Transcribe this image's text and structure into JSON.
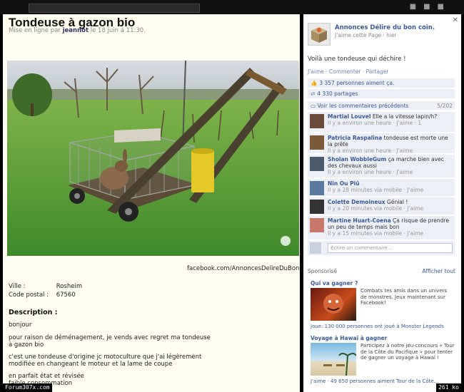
{
  "ad": {
    "title": "Tondeuse à gazon bio",
    "meta_prefix": "Mise en ligne par",
    "author": "jeannot",
    "meta_date": "le 18 juin à 11:30.",
    "watermark": "facebook.com/AnnoncesDelireDuBonCoin",
    "ville_label": "Ville :",
    "ville_value": "Rosheim",
    "cp_label": "Code postal :",
    "cp_value": "67560",
    "description_label": "Description :",
    "description": [
      "bonjour",
      "pour raison de déménagement, je vends avec regret ma tondeuse",
      "à gazon bio",
      "c'est une tondeuse d'origine jc motoculture que j'ai légèrement",
      "modifiée en changeant le moteur et la lame de coupe",
      "en parfait état et révisée",
      "faible consommation"
    ]
  },
  "fb": {
    "page_name": "Annonces Délire du bon coin.",
    "page_sub": "J'aime cette Page · hier",
    "post_text": "Voilà une tondeuse qui déchire !",
    "actions": "J'aime · Commenter · Partager",
    "likes": "3 357 personnes aiment ça.",
    "shares": "4 330 partages",
    "previous": "Voir les commentaires précédents",
    "previous_count": "5/202",
    "comments": [
      {
        "name": "Martial Louvel",
        "text": "Elle a la vitesse lapin/h?",
        "time": "Il y a environ une heure · J'aime · 1"
      },
      {
        "name": "Patricia Raspalina",
        "text": "tondeuse est morte une la prête",
        "time": "Il y a environ une heure · J'aime"
      },
      {
        "name": "Sholan WobbleGum",
        "text": "ça marche bien avec des chevaux aussi",
        "time": "Il y a environ une heure · J'aime"
      },
      {
        "name": "Nin Ou Piû",
        "text": "",
        "time": "Il y a 28 minutes via mobile · J'aime"
      },
      {
        "name": "Colette Demoineux",
        "text": "Génial !",
        "time": "Il y a 20 minutes via mobile · J'aime"
      },
      {
        "name": "Martine Huart-Coena",
        "text": "Ça risque de prendre un peu de temps mais bon",
        "time": "Il y a 15 minutes via mobile · J'aime"
      }
    ],
    "reply_placeholder": "Écrire un commentaire...",
    "sponsored_label": "Sponsorisé",
    "show_all": "Afficher tout",
    "ad1_title": "Qui va gagner ?",
    "ad1_text": "Combats tes amis dans un univers de monstres. Jeux maintenant sur Facebook!",
    "ad1_sub": "Joue: 130 000 personnes ont joué à Monster Legends",
    "ad2_title": "Voyage à Hawaï à gagner",
    "ad2_text": "Participez à notre jeu-concours « Tour de la Côte du Pacifique » pour tenter de gagner un voyage à Hawaï !",
    "ad2_sub": "J'aime · 49 650 personnes aiment Tour de la Côte..."
  },
  "footer": {
    "left": "Forum307x.com",
    "right": "261 ko"
  },
  "colors": {
    "panel_bg": "#fffef0",
    "fb_blue": "#3b5998",
    "fb_light": "#eceff5"
  }
}
